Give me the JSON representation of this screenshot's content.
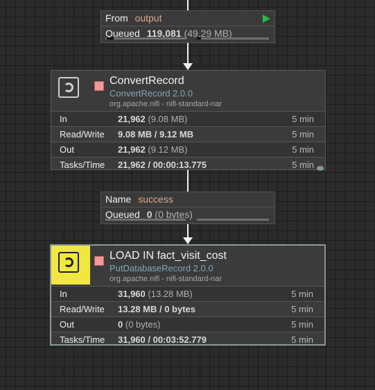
{
  "connection1": {
    "label_from": "From",
    "from_value": "output",
    "label_queued": "Queued",
    "queued_count": "119,081",
    "queued_size": "(49.29 MB)"
  },
  "processor1": {
    "name": "ConvertRecord",
    "type": "ConvertRecord 2.0.0",
    "bundle": "org.apache.nifi - nifi-standard-nar",
    "stats": {
      "in_label": "In",
      "in_value": "21,962",
      "in_size": "(9.08 MB)",
      "in_time": "5 min",
      "rw_label": "Read/Write",
      "rw_value": "9.08 MB / 9.12 MB",
      "rw_time": "5 min",
      "out_label": "Out",
      "out_value": "21,962",
      "out_size": "(9.12 MB)",
      "out_time": "5 min",
      "tasks_label": "Tasks/Time",
      "tasks_value": "21,962 / 00:00:13.775",
      "tasks_time": "5 min"
    }
  },
  "connection2": {
    "label_name": "Name",
    "name_value": "success",
    "label_queued": "Queued",
    "queued_count": "0",
    "queued_size": "(0 bytes)"
  },
  "processor2": {
    "name": "LOAD IN fact_visit_cost",
    "type": "PutDatabaseRecord 2.0.0",
    "bundle": "org.apache.nifi - nifi-standard-nar",
    "stats": {
      "in_label": "In",
      "in_value": "31,960",
      "in_size": "(13.28 MB)",
      "in_time": "5 min",
      "rw_label": "Read/Write",
      "rw_value": "13.28 MB / 0 bytes",
      "rw_time": "5 min",
      "out_label": "Out",
      "out_value": "0",
      "out_size": "(0 bytes)",
      "out_time": "5 min",
      "tasks_label": "Tasks/Time",
      "tasks_value": "31,960 / 00:03:52.779",
      "tasks_time": "5 min"
    }
  },
  "colors": {
    "accent": "#d9a88a",
    "type_text": "#7fa7b8",
    "stopped": "#f29898",
    "icon_highlight": "#f0e840",
    "running": "#2fb84a"
  }
}
